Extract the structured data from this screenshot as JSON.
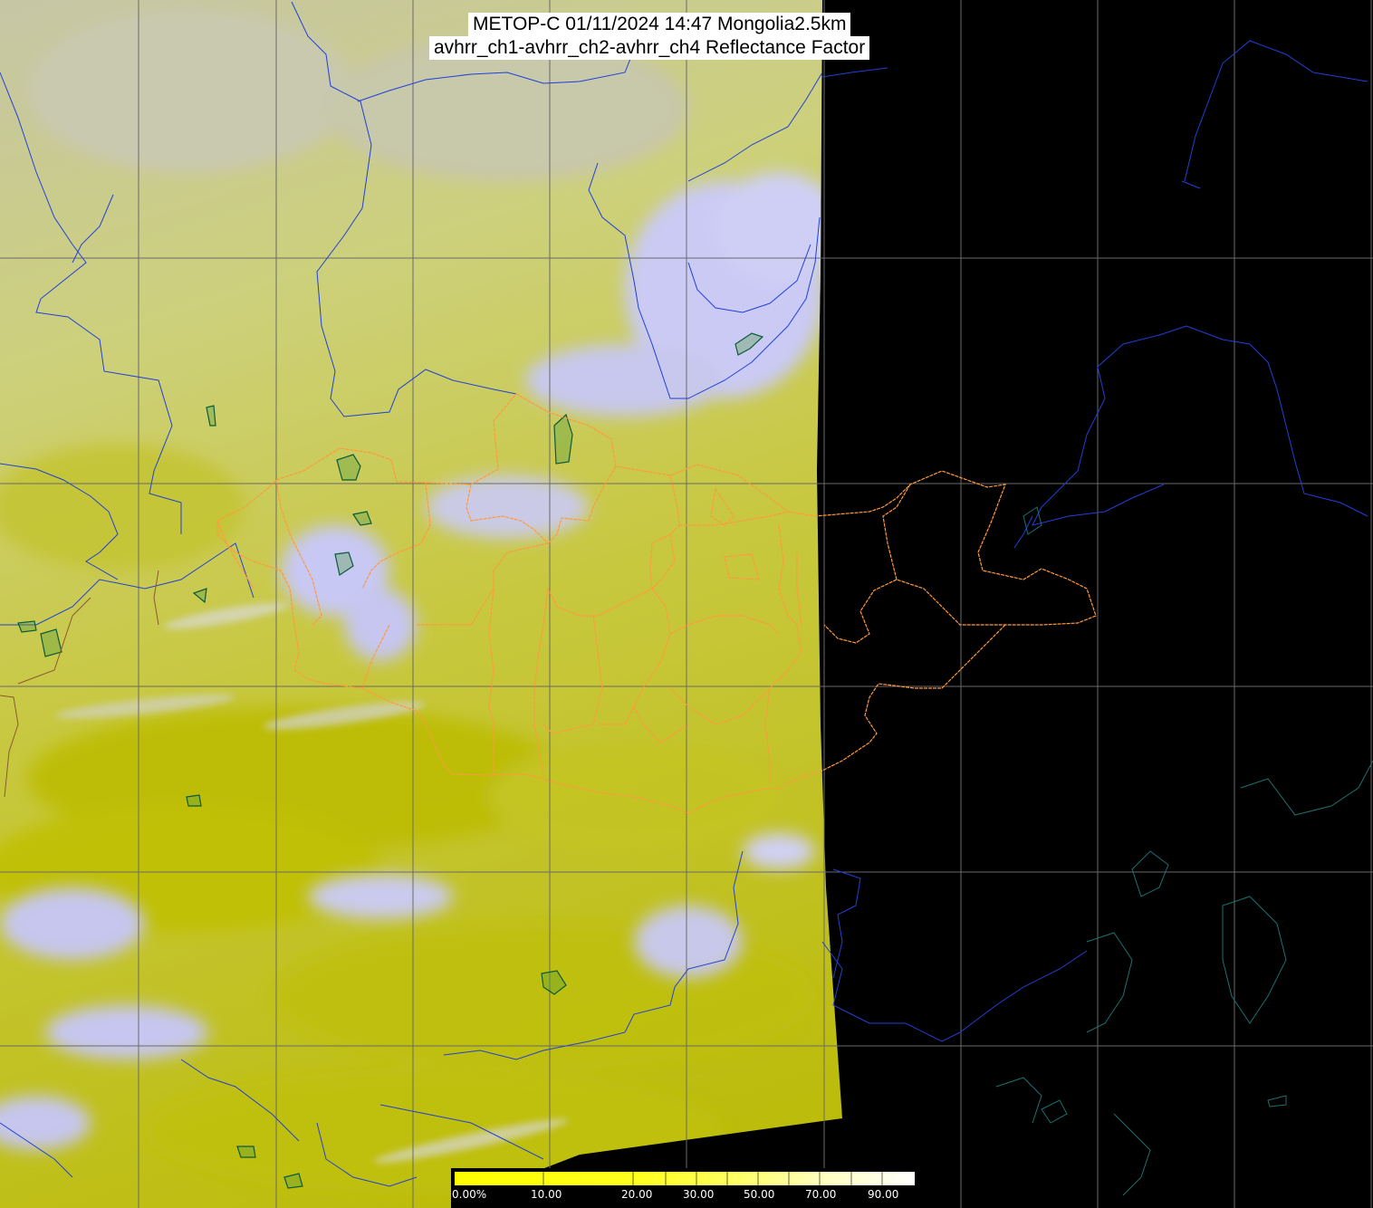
{
  "title": {
    "line1": "METOP-C 01/11/2024 14:47 Mongolia2.5km",
    "line2": "avhrr_ch1-avhrr_ch2-avhrr_ch4 Reflectance Factor"
  },
  "colors": {
    "background": "#000000",
    "surface_dark": "#bcbc00",
    "surface_mid": "#cfd24a",
    "surface_light": "#c9ca96",
    "cloud": "#c6c6f2",
    "graticule": "#6a6a6a",
    "rivers_coast": "#1f3fd0",
    "admin_borders": "#ff9a3c",
    "lakes_outline": "#0c5a3a"
  },
  "colorbar": {
    "labels": [
      "0.00%",
      "10.00",
      "20.00",
      "30.00",
      "50.00",
      "70.00",
      "90.00"
    ],
    "gradient_stops": [
      "#ffff00",
      "#ffff10",
      "#ffff40",
      "#ffff80",
      "#ffffc0",
      "#ffffff"
    ]
  }
}
